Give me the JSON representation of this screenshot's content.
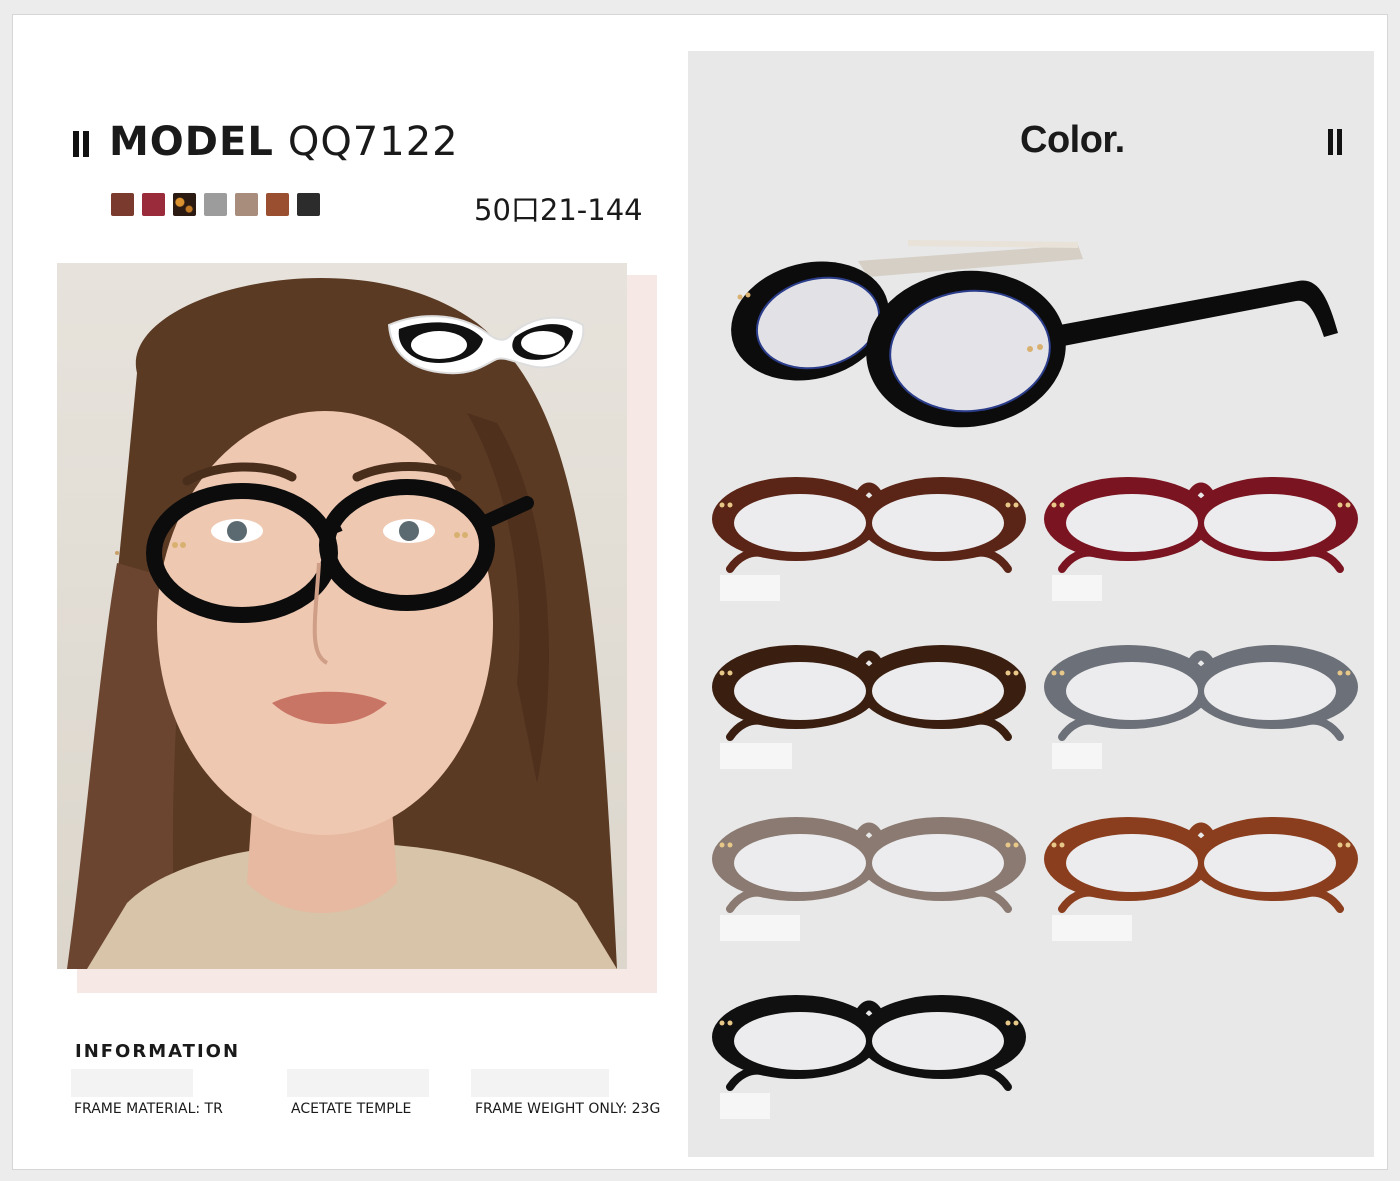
{
  "header": {
    "title_bold": "MODEL",
    "title_model": "QQ7122",
    "size": "50口21-144"
  },
  "swatches": [
    {
      "name": "brown",
      "color": "#7a3a2e"
    },
    {
      "name": "wine",
      "color": "#9a2b3a"
    },
    {
      "name": "tortoise",
      "color": "#3a2418"
    },
    {
      "name": "grey",
      "color": "#9c9c9c"
    },
    {
      "name": "taupe",
      "color": "#a88c7c"
    },
    {
      "name": "caramel",
      "color": "#9a5030"
    },
    {
      "name": "black",
      "color": "#2c2c2c"
    }
  ],
  "information": {
    "title": "INFORMATION",
    "items": [
      "FRAME MATERIAL: TR",
      "ACETATE TEMPLE",
      "FRAME WEIGHT ONLY: 23G"
    ]
  },
  "color_panel": {
    "title": "Color.",
    "hero_color": "#0c0c0c",
    "variants": [
      {
        "name": "brown",
        "frame": "#5a2416",
        "highlight": "#8a4030"
      },
      {
        "name": "wine",
        "frame": "#7a1420",
        "highlight": "#b03040"
      },
      {
        "name": "tortoise",
        "frame": "#3a1e10",
        "highlight": "#b06828"
      },
      {
        "name": "grey",
        "frame": "#6c7078",
        "highlight": "#9ea2aa"
      },
      {
        "name": "taupe",
        "frame": "#8a7a72",
        "highlight": "#b4a69c"
      },
      {
        "name": "caramel",
        "frame": "#8a3e1e",
        "highlight": "#c06a40"
      },
      {
        "name": "black",
        "frame": "#101010",
        "highlight": "#444444"
      }
    ]
  }
}
